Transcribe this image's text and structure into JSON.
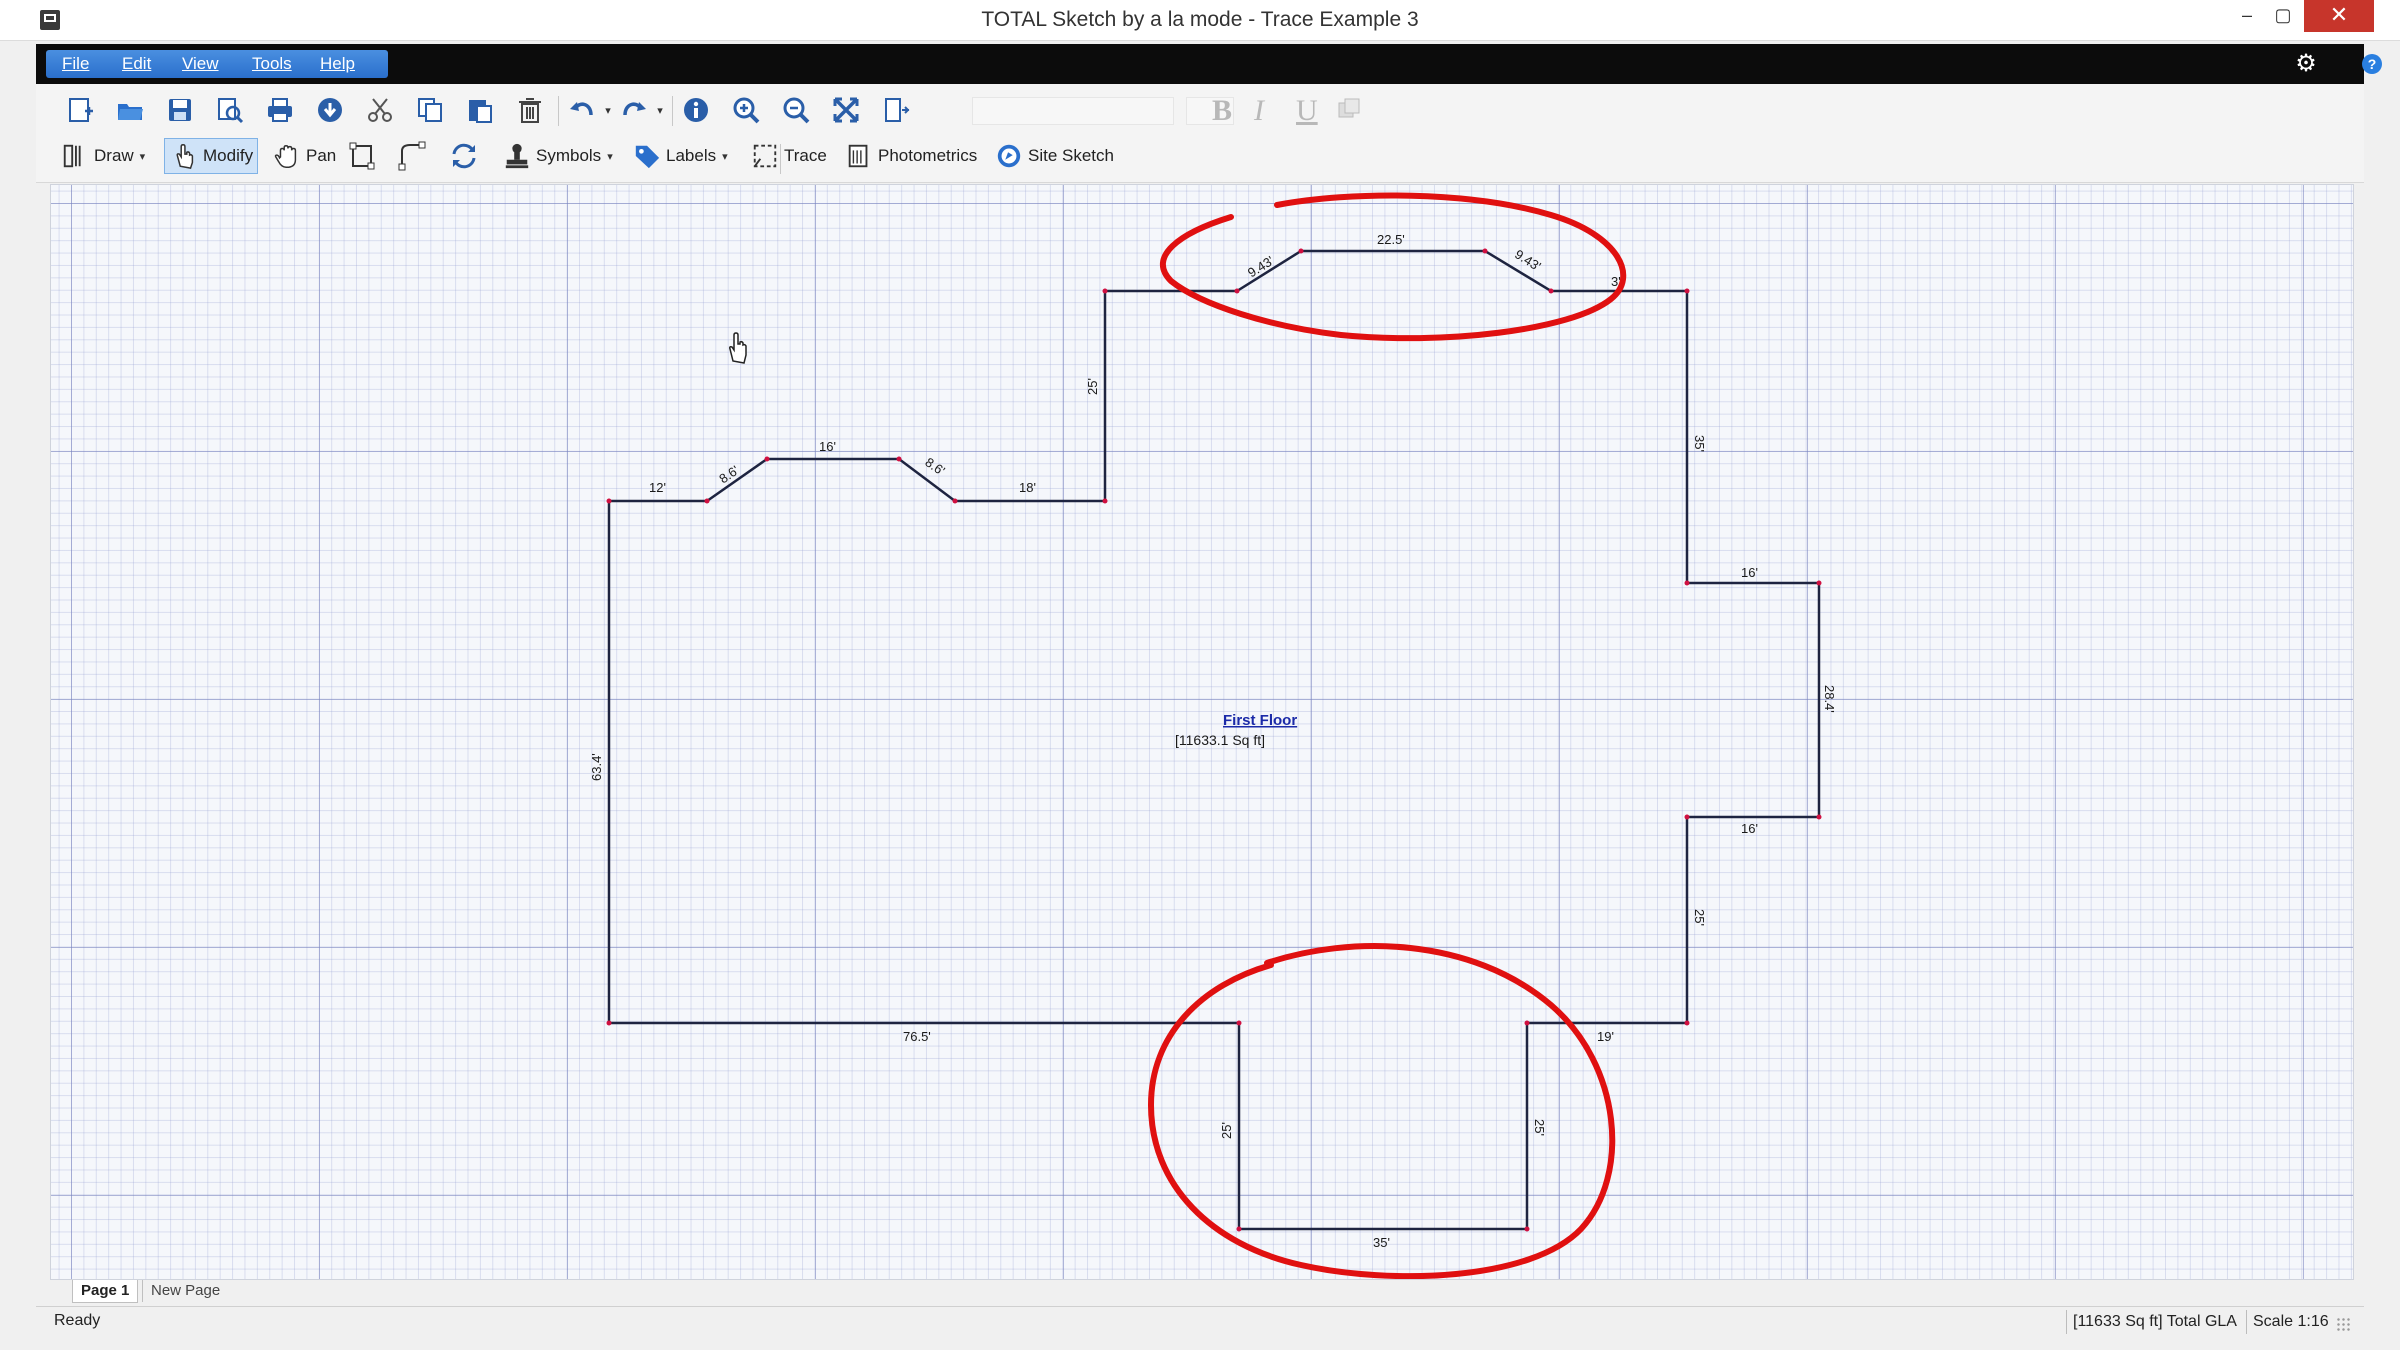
{
  "window": {
    "title": "TOTAL Sketch by a la mode - Trace Example 3",
    "min_glyph": "–",
    "max_glyph": "▢",
    "close_glyph": "✕"
  },
  "menu": {
    "items": [
      "File",
      "Edit",
      "View",
      "Tools",
      "Help"
    ]
  },
  "toolbar": {
    "row1_icons": [
      "new-sketch-icon",
      "open-folder-icon",
      "save-icon",
      "print-preview-icon",
      "print-icon",
      "download-icon",
      "cut-icon",
      "copy-icon",
      "paste-icon",
      "delete-icon",
      "undo-icon",
      "redo-icon",
      "info-icon",
      "zoom-in-icon",
      "zoom-out-icon",
      "fit-to-window-icon",
      "page-width-icon"
    ],
    "format_letters": [
      "B",
      "I",
      "U"
    ],
    "draw_label": "Draw",
    "modify_label": "Modify",
    "pan_label": "Pan",
    "symbols_label": "Symbols",
    "labels_label": "Labels",
    "trace_label": "Trace",
    "photometrics_label": "Photometrics",
    "site_sketch_label": "Site Sketch",
    "accent_color": "#2a6fcc"
  },
  "sketch": {
    "area_name": "First Floor",
    "area_size": "[11633.1 Sq ft]",
    "dimensions": {
      "left_top_1": "12'",
      "left_diag_1": "8.6'",
      "left_top_2": "16'",
      "left_diag_2": "8.6'",
      "left_top_3": "18'",
      "step_vertical": "25'",
      "top_diag_1": "9.43'",
      "top_flat": "22.5'",
      "top_diag_2": "9.43'",
      "top_right_stub": "3'",
      "right_upper": "35'",
      "bump_top": "16'",
      "bump_side": "28.4'",
      "bump_bottom": "16'",
      "right_lower": "25'",
      "left_side": "63.4'",
      "bottom_left": "76.5'",
      "bottom_right": "19'",
      "notch_left": "25'",
      "notch_right": "25'",
      "notch_bottom": "35'"
    },
    "highlight_color": "#e01010",
    "line_color": "#1e2440"
  },
  "pages": {
    "active": "Page 1",
    "new_page": "New Page"
  },
  "status": {
    "left": "Ready",
    "gla": "[11633 Sq ft] Total GLA",
    "scale": "Scale 1:16"
  }
}
